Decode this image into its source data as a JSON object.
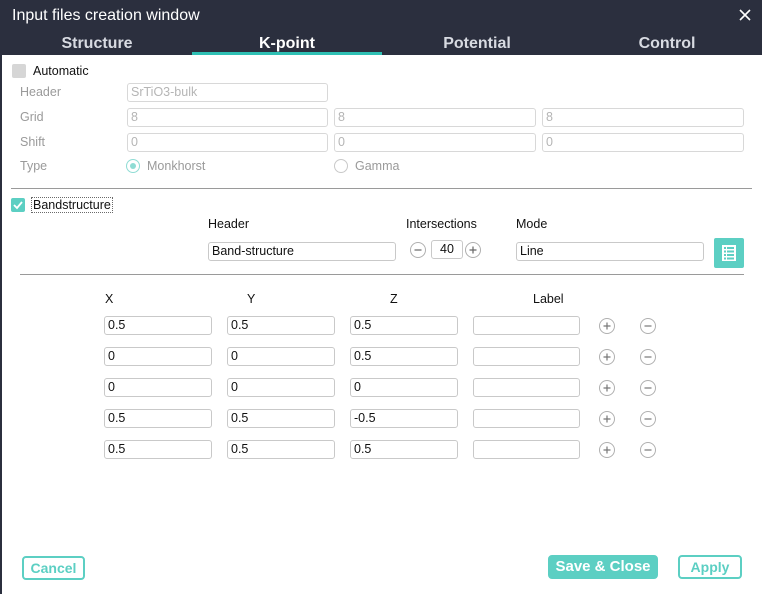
{
  "window": {
    "title": "Input files creation window"
  },
  "tabs": [
    "Structure",
    "K-point",
    "Potential",
    "Control"
  ],
  "automatic": {
    "label": "Automatic",
    "checked": false,
    "header_label": "Header",
    "header_value": "SrTiO3-bulk",
    "grid_label": "Grid",
    "grid_values": [
      "8",
      "8",
      "8"
    ],
    "shift_label": "Shift",
    "shift_values": [
      "0",
      "0",
      "0"
    ],
    "type_label": "Type",
    "type_options": [
      "Monkhorst",
      "Gamma"
    ],
    "type_selected": "Monkhorst"
  },
  "bandstructure": {
    "label": "Bandstructure",
    "checked": true,
    "header_label": "Header",
    "header_value": "Band-structure",
    "intersections_label": "Intersections",
    "intersections_value": "40",
    "mode_label": "Mode",
    "mode_value": "Line",
    "table_icon": "table-icon"
  },
  "kpath": {
    "columns": [
      "X",
      "Y",
      "Z",
      "Label"
    ],
    "rows": [
      {
        "x": "0.5",
        "y": "0.5",
        "z": "0.5",
        "label": ""
      },
      {
        "x": "0",
        "y": "0",
        "z": "0.5",
        "label": ""
      },
      {
        "x": "0",
        "y": "0",
        "z": "0",
        "label": ""
      },
      {
        "x": "0.5",
        "y": "0.5",
        "z": "-0.5",
        "label": ""
      },
      {
        "x": "0.5",
        "y": "0.5",
        "z": "0.5",
        "label": ""
      }
    ]
  },
  "footer": {
    "cancel_label": "Cancel",
    "save_close_label": "Save & Close",
    "apply_label": "Apply"
  },
  "colors": {
    "accent": "#5ccfc3",
    "titlebar": "#2b2f3e"
  }
}
